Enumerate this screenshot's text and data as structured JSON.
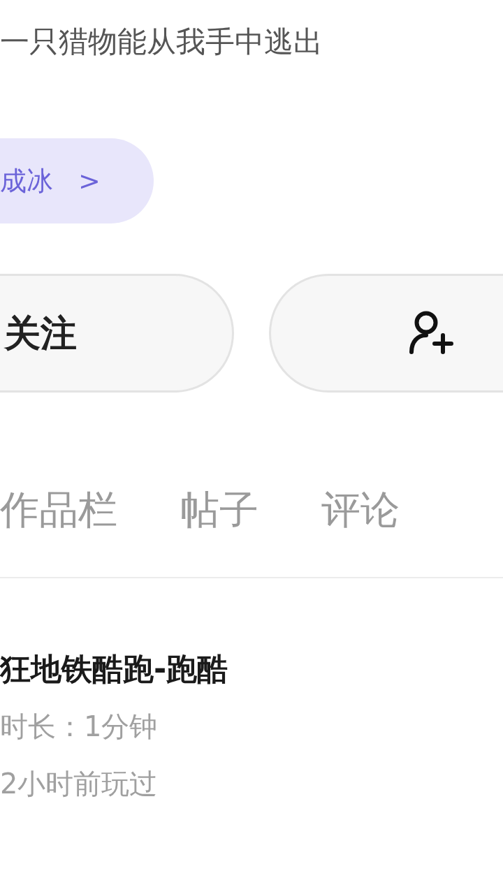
{
  "bio": "一只猎物能从我手中逃出",
  "tag": {
    "label": "成冰",
    "chevron": ">"
  },
  "actions": [
    {
      "kind": "text",
      "label": "关注"
    },
    {
      "kind": "icon"
    }
  ],
  "tabs": [
    {
      "label": "作品栏",
      "selected": false
    },
    {
      "label": "帖子",
      "selected": false
    },
    {
      "label": "评论",
      "selected": false
    }
  ],
  "games": [
    {
      "title": "狂地铁酷跑-跑酷",
      "duration": "时长：1分钟",
      "played": "2小时前玩过"
    }
  ]
}
